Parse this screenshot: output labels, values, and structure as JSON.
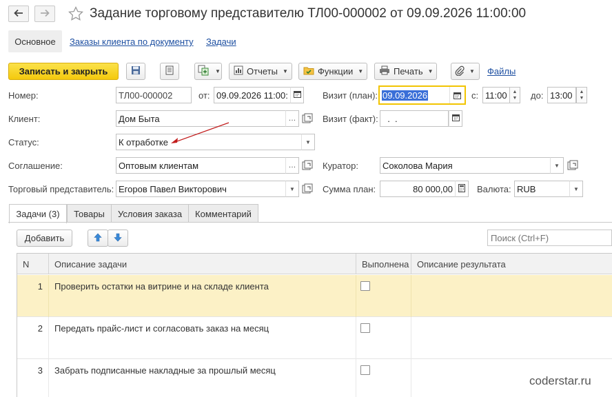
{
  "window": {
    "title": "Задание торговому представителю ТЛ00-000002 от 09.09.2026 11:00:00"
  },
  "sections": {
    "main": "Основное",
    "orders": "Заказы клиента по документу",
    "tasks": "Задачи"
  },
  "toolbar": {
    "save_close": "Записать и закрыть",
    "reports": "Отчеты",
    "functions": "Функции",
    "print": "Печать",
    "files": "Файлы"
  },
  "form": {
    "number_label": "Номер:",
    "number_value": "ТЛ00-000002",
    "from_label": "от:",
    "from_value": "09.09.2026 11:00:",
    "visit_plan_label": "Визит (план):",
    "visit_plan_value": "09.09.2026",
    "since_label": "с:",
    "since_value": "11:00",
    "to_label": "до:",
    "to_value": "13:00",
    "client_label": "Клиент:",
    "client_value": "Дом Быта",
    "visit_fact_label": "Визит (факт):",
    "visit_fact_value": "  .  .",
    "status_label": "Статус:",
    "status_value": "К отработке",
    "agreement_label": "Соглашение:",
    "agreement_value": "Оптовым клиентам",
    "curator_label": "Куратор:",
    "curator_value": "Соколова Мария",
    "rep_label": "Торговый представитель:",
    "rep_value": "Егоров Павел Викторович",
    "sum_label": "Сумма план:",
    "sum_value": "80 000,00",
    "currency_label": "Валюта:",
    "currency_value": "RUB"
  },
  "tabs": [
    {
      "label": "Задачи (3)"
    },
    {
      "label": "Товары"
    },
    {
      "label": "Условия заказа"
    },
    {
      "label": "Комментарий"
    }
  ],
  "tasks_panel": {
    "add_button": "Добавить",
    "search_placeholder": "Поиск (Ctrl+F)",
    "columns": {
      "n": "N",
      "description": "Описание задачи",
      "done": "Выполнена",
      "result": "Описание результата"
    },
    "rows": [
      {
        "n": "1",
        "description": "Проверить остатки на витрине и на складе клиента",
        "done": false,
        "result": ""
      },
      {
        "n": "2",
        "description": "Передать прайс-лист и согласовать заказ на месяц",
        "done": false,
        "result": ""
      },
      {
        "n": "3",
        "description": "Забрать подписанные накладные за прошлый месяц",
        "done": false,
        "result": ""
      }
    ]
  },
  "watermark": "coderstar.ru",
  "colors": {
    "primary_button": "#f4c90d",
    "selected_row": "#fcf1c6",
    "link": "#1d4fa1",
    "annotation_arrow": "#c21d1d",
    "focus_border": "#f2c400"
  }
}
